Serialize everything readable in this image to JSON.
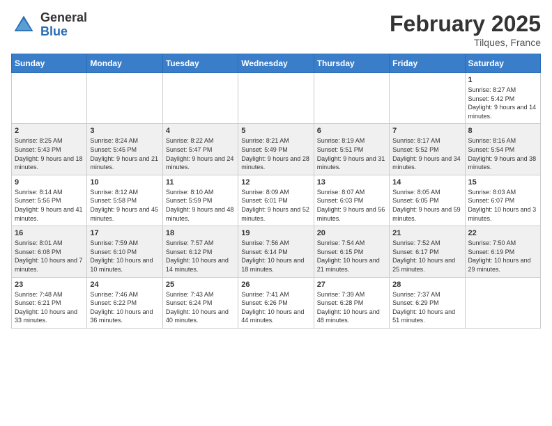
{
  "header": {
    "logo_general": "General",
    "logo_blue": "Blue",
    "title": "February 2025",
    "subtitle": "Tilques, France"
  },
  "days_of_week": [
    "Sunday",
    "Monday",
    "Tuesday",
    "Wednesday",
    "Thursday",
    "Friday",
    "Saturday"
  ],
  "weeks": [
    [
      {
        "day": "",
        "info": ""
      },
      {
        "day": "",
        "info": ""
      },
      {
        "day": "",
        "info": ""
      },
      {
        "day": "",
        "info": ""
      },
      {
        "day": "",
        "info": ""
      },
      {
        "day": "",
        "info": ""
      },
      {
        "day": "1",
        "info": "Sunrise: 8:27 AM\nSunset: 5:42 PM\nDaylight: 9 hours and 14 minutes."
      }
    ],
    [
      {
        "day": "2",
        "info": "Sunrise: 8:25 AM\nSunset: 5:43 PM\nDaylight: 9 hours and 18 minutes."
      },
      {
        "day": "3",
        "info": "Sunrise: 8:24 AM\nSunset: 5:45 PM\nDaylight: 9 hours and 21 minutes."
      },
      {
        "day": "4",
        "info": "Sunrise: 8:22 AM\nSunset: 5:47 PM\nDaylight: 9 hours and 24 minutes."
      },
      {
        "day": "5",
        "info": "Sunrise: 8:21 AM\nSunset: 5:49 PM\nDaylight: 9 hours and 28 minutes."
      },
      {
        "day": "6",
        "info": "Sunrise: 8:19 AM\nSunset: 5:51 PM\nDaylight: 9 hours and 31 minutes."
      },
      {
        "day": "7",
        "info": "Sunrise: 8:17 AM\nSunset: 5:52 PM\nDaylight: 9 hours and 34 minutes."
      },
      {
        "day": "8",
        "info": "Sunrise: 8:16 AM\nSunset: 5:54 PM\nDaylight: 9 hours and 38 minutes."
      }
    ],
    [
      {
        "day": "9",
        "info": "Sunrise: 8:14 AM\nSunset: 5:56 PM\nDaylight: 9 hours and 41 minutes."
      },
      {
        "day": "10",
        "info": "Sunrise: 8:12 AM\nSunset: 5:58 PM\nDaylight: 9 hours and 45 minutes."
      },
      {
        "day": "11",
        "info": "Sunrise: 8:10 AM\nSunset: 5:59 PM\nDaylight: 9 hours and 48 minutes."
      },
      {
        "day": "12",
        "info": "Sunrise: 8:09 AM\nSunset: 6:01 PM\nDaylight: 9 hours and 52 minutes."
      },
      {
        "day": "13",
        "info": "Sunrise: 8:07 AM\nSunset: 6:03 PM\nDaylight: 9 hours and 56 minutes."
      },
      {
        "day": "14",
        "info": "Sunrise: 8:05 AM\nSunset: 6:05 PM\nDaylight: 9 hours and 59 minutes."
      },
      {
        "day": "15",
        "info": "Sunrise: 8:03 AM\nSunset: 6:07 PM\nDaylight: 10 hours and 3 minutes."
      }
    ],
    [
      {
        "day": "16",
        "info": "Sunrise: 8:01 AM\nSunset: 6:08 PM\nDaylight: 10 hours and 7 minutes."
      },
      {
        "day": "17",
        "info": "Sunrise: 7:59 AM\nSunset: 6:10 PM\nDaylight: 10 hours and 10 minutes."
      },
      {
        "day": "18",
        "info": "Sunrise: 7:57 AM\nSunset: 6:12 PM\nDaylight: 10 hours and 14 minutes."
      },
      {
        "day": "19",
        "info": "Sunrise: 7:56 AM\nSunset: 6:14 PM\nDaylight: 10 hours and 18 minutes."
      },
      {
        "day": "20",
        "info": "Sunrise: 7:54 AM\nSunset: 6:15 PM\nDaylight: 10 hours and 21 minutes."
      },
      {
        "day": "21",
        "info": "Sunrise: 7:52 AM\nSunset: 6:17 PM\nDaylight: 10 hours and 25 minutes."
      },
      {
        "day": "22",
        "info": "Sunrise: 7:50 AM\nSunset: 6:19 PM\nDaylight: 10 hours and 29 minutes."
      }
    ],
    [
      {
        "day": "23",
        "info": "Sunrise: 7:48 AM\nSunset: 6:21 PM\nDaylight: 10 hours and 33 minutes."
      },
      {
        "day": "24",
        "info": "Sunrise: 7:46 AM\nSunset: 6:22 PM\nDaylight: 10 hours and 36 minutes."
      },
      {
        "day": "25",
        "info": "Sunrise: 7:43 AM\nSunset: 6:24 PM\nDaylight: 10 hours and 40 minutes."
      },
      {
        "day": "26",
        "info": "Sunrise: 7:41 AM\nSunset: 6:26 PM\nDaylight: 10 hours and 44 minutes."
      },
      {
        "day": "27",
        "info": "Sunrise: 7:39 AM\nSunset: 6:28 PM\nDaylight: 10 hours and 48 minutes."
      },
      {
        "day": "28",
        "info": "Sunrise: 7:37 AM\nSunset: 6:29 PM\nDaylight: 10 hours and 51 minutes."
      },
      {
        "day": "",
        "info": ""
      }
    ]
  ]
}
